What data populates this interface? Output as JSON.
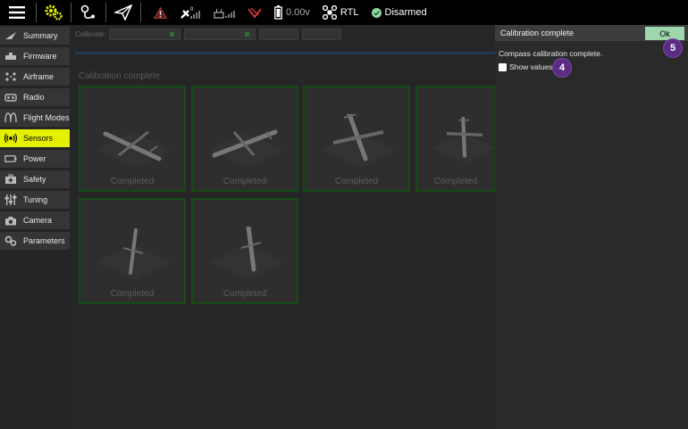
{
  "toolbar": {
    "voltage": "0.00v",
    "flight_mode": "RTL",
    "arm_status": "Disarmed",
    "accent": "#e5f000"
  },
  "sidebar": {
    "items": [
      {
        "label": "Summary",
        "icon": "summary-icon",
        "active": false
      },
      {
        "label": "Firmware",
        "icon": "firmware-icon",
        "active": false
      },
      {
        "label": "Airframe",
        "icon": "airframe-icon",
        "active": false
      },
      {
        "label": "Radio",
        "icon": "radio-icon",
        "active": false
      },
      {
        "label": "Flight Modes",
        "icon": "flight-modes-icon",
        "active": false
      },
      {
        "label": "Sensors",
        "icon": "sensors-icon",
        "active": true
      },
      {
        "label": "Power",
        "icon": "power-icon",
        "active": false
      },
      {
        "label": "Safety",
        "icon": "safety-icon",
        "active": false
      },
      {
        "label": "Tuning",
        "icon": "tuning-icon",
        "active": false
      },
      {
        "label": "Camera",
        "icon": "camera-icon",
        "active": false
      },
      {
        "label": "Parameters",
        "icon": "parameters-icon",
        "active": false
      }
    ]
  },
  "main": {
    "calibrate_label": "Calibrate:",
    "section_title": "Calibration complete",
    "tiles": [
      {
        "caption": "Completed"
      },
      {
        "caption": "Completed"
      },
      {
        "caption": "Completed"
      },
      {
        "caption": "Completed"
      },
      {
        "caption": "Completed"
      },
      {
        "caption": "Completed"
      }
    ]
  },
  "dialog": {
    "title": "Calibration complete",
    "ok_label": "Ok",
    "message": "Compass calibration complete.",
    "show_values_label": "Show values"
  },
  "badges": {
    "ok_badge": "5",
    "show_values_badge": "4"
  }
}
